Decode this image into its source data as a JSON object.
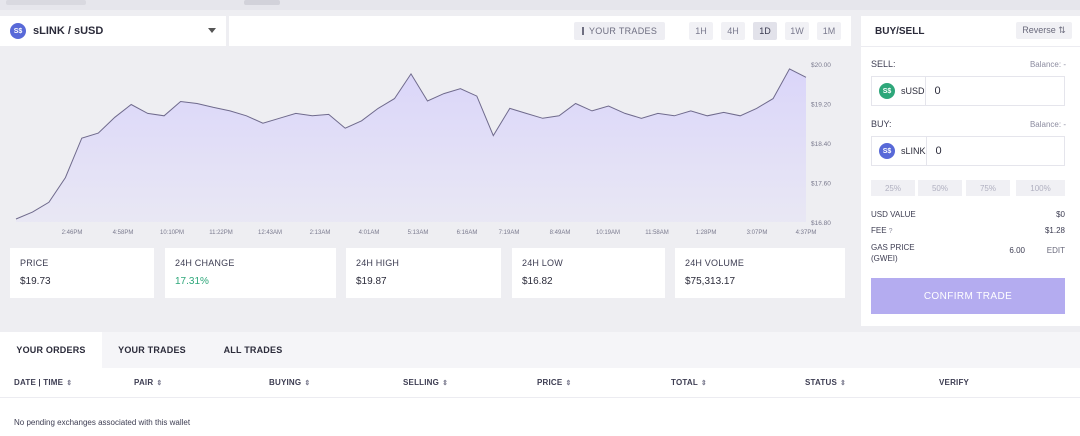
{
  "pair": {
    "icon": "sx-coin-icon",
    "icon_text": "S$",
    "label": "sLINK / sUSD"
  },
  "chart_controls": {
    "your_trades": "YOUR TRADES",
    "timeframes": [
      "1H",
      "4H",
      "1D",
      "1W",
      "1M"
    ],
    "active_timeframe": "1D"
  },
  "chart_data": {
    "type": "area",
    "x": [
      "2:46PM",
      "4:58PM",
      "10:10PM",
      "11:22PM",
      "12:43AM",
      "2:13AM",
      "4:01AM",
      "5:13AM",
      "6:16AM",
      "7:19AM",
      "8:49AM",
      "10:19AM",
      "11:58AM",
      "1:28PM",
      "3:07PM",
      "4:37PM"
    ],
    "y": [
      16.86,
      17.0,
      17.2,
      17.7,
      18.5,
      18.6,
      18.92,
      19.18,
      19.0,
      18.95,
      19.24,
      19.2,
      19.12,
      19.05,
      18.95,
      18.8,
      18.9,
      19.0,
      18.95,
      18.98,
      18.7,
      18.85,
      19.1,
      19.3,
      19.8,
      19.25,
      19.4,
      19.5,
      19.35,
      18.55,
      19.1,
      19.0,
      18.9,
      18.95,
      19.2,
      19.05,
      19.15,
      19.0,
      18.9,
      19.0,
      18.95,
      19.05,
      18.95,
      19.02,
      18.95,
      19.1,
      19.3,
      19.9,
      19.73
    ],
    "yticks": [
      "$20.00",
      "$19.20",
      "$18.40",
      "$17.60",
      "$16.80"
    ],
    "ylim": [
      16.8,
      20.0
    ],
    "grid": false,
    "fill_color": "#d9d4fa",
    "line_color": "#6f6a8c"
  },
  "stats": [
    {
      "label": "PRICE",
      "value": "$19.73"
    },
    {
      "label": "24H CHANGE",
      "value": "17.31%"
    },
    {
      "label": "24H HIGH",
      "value": "$19.87"
    },
    {
      "label": "24H LOW",
      "value": "$16.82"
    },
    {
      "label": "24H VOLUME",
      "value": "$75,313.17"
    }
  ],
  "buy_sell": {
    "title": "BUY/SELL",
    "reverse": "Reverse ⇅",
    "sell_label": "SELL:",
    "sell_balance": "Balance: -",
    "sell_token": "sUSD",
    "sell_token_icon": "S$",
    "sell_value": "0",
    "buy_label": "BUY:",
    "buy_balance": "Balance: -",
    "buy_token": "sLINK",
    "buy_token_icon": "S$",
    "buy_value": "0",
    "percents": [
      "25%",
      "50%",
      "75%",
      "100%"
    ],
    "usd_value_label": "USD VALUE",
    "usd_value": "$0",
    "fee_label": "FEE",
    "fee_hint": "?",
    "fee": "$1.28",
    "gas_label": "GAS PRICE (GWEI)",
    "gas_value": "6.00",
    "gas_edit": "EDIT",
    "confirm": "CONFIRM TRADE",
    "colors": {
      "confirm_bg": "#b4acf0",
      "positive": "#2ea77a"
    }
  },
  "orders": {
    "tabs": [
      "YOUR ORDERS",
      "YOUR TRADES",
      "ALL TRADES"
    ],
    "columns": [
      "DATE | TIME",
      "PAIR",
      "BUYING",
      "SELLING",
      "PRICE",
      "TOTAL",
      "STATUS",
      "VERIFY"
    ],
    "empty_message": "No pending exchanges associated with this wallet"
  }
}
